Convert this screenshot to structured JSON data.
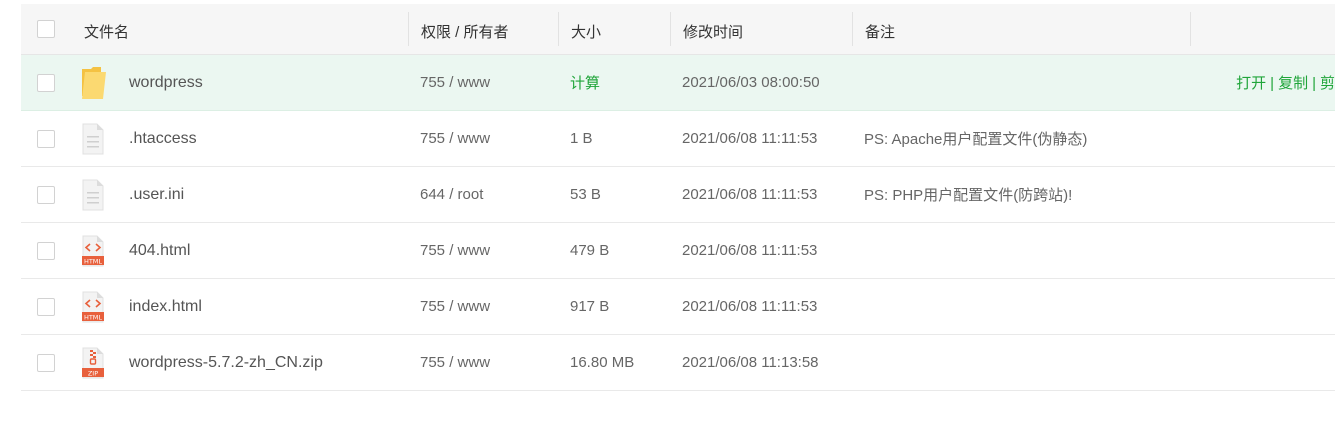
{
  "header": {
    "name": "文件名",
    "permission": "权限 / 所有者",
    "size": "大小",
    "mtime": "修改时间",
    "note": "备注"
  },
  "files": [
    {
      "name": "wordpress",
      "icon": "folder-icon",
      "perm": "755 / www",
      "size": "计算",
      "time": "2021/06/03 08:00:50",
      "note": ""
    },
    {
      "name": ".htaccess",
      "icon": "text-file-icon",
      "perm": "755 / www",
      "size": "1 B",
      "time": "2021/06/08 11:11:53",
      "note": "PS: Apache用户配置文件(伪静态)"
    },
    {
      "name": ".user.ini",
      "icon": "text-file-icon",
      "perm": "644 / root",
      "size": "53 B",
      "time": "2021/06/08 11:11:53",
      "note": "PS: PHP用户配置文件(防跨站)!"
    },
    {
      "name": "404.html",
      "icon": "html-file-icon",
      "perm": "755 / www",
      "size": "479 B",
      "time": "2021/06/08 11:11:53",
      "note": ""
    },
    {
      "name": "index.html",
      "icon": "html-file-icon",
      "perm": "755 / www",
      "size": "917 B",
      "time": "2021/06/08 11:11:53",
      "note": ""
    },
    {
      "name": "wordpress-5.7.2-zh_CN.zip",
      "icon": "zip-file-icon",
      "perm": "755 / www",
      "size": "16.80 MB",
      "time": "2021/06/08 11:13:58",
      "note": ""
    }
  ],
  "row_actions": {
    "open": "打开",
    "copy": "复制",
    "cut": "剪"
  },
  "icon_labels": {
    "html": "HTML",
    "zip": "ZIP"
  },
  "colors": {
    "accent": "#20a53a",
    "active_row": "#ebf7f1",
    "folder": "#f7c84a",
    "html_badge": "#e8603c"
  }
}
